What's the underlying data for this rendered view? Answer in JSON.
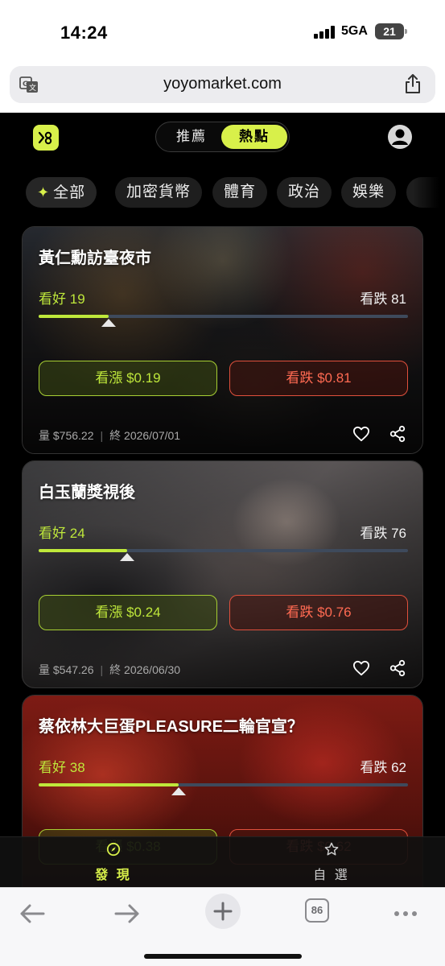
{
  "status": {
    "time": "14:24",
    "network": "5GA",
    "battery": "21"
  },
  "browser": {
    "url": "yoyomarket.com",
    "tab_count": "86"
  },
  "topnav": {
    "tabs": [
      {
        "label": "推薦",
        "active": false
      },
      {
        "label": "熱點",
        "active": true
      }
    ]
  },
  "categories": [
    {
      "label": "全部",
      "active": true
    },
    {
      "label": "加密貨幣",
      "active": false
    },
    {
      "label": "體育",
      "active": false
    },
    {
      "label": "政治",
      "active": false
    },
    {
      "label": "娛樂",
      "active": false
    }
  ],
  "markets": [
    {
      "title": "黃仁勳訪臺夜市",
      "bull_label": "看好",
      "bull_pct": 19,
      "bear_label": "看跌",
      "bear_pct": 81,
      "buy_label": "看漲 $0.19",
      "sell_label": "看跌 $0.81",
      "volume": "量 $756.22",
      "end": "終 2026/07/01"
    },
    {
      "title": "白玉蘭獎視後",
      "bull_label": "看好",
      "bull_pct": 24,
      "bear_label": "看跌",
      "bear_pct": 76,
      "buy_label": "看漲 $0.24",
      "sell_label": "看跌 $0.76",
      "volume": "量 $547.26",
      "end": "終 2026/06/30"
    },
    {
      "title": "蔡依林大巨蛋PLEASURE二輪官宣？",
      "bull_label": "看好",
      "bull_pct": 38,
      "bear_label": "看跌",
      "bear_pct": 62,
      "buy_label": "看漲 $0.38",
      "sell_label": "看跌 $0.62",
      "volume": "",
      "end": ""
    }
  ],
  "bottomnav": {
    "discover": "發 現",
    "favorites": "自 選"
  },
  "colors": {
    "accent": "#d8f04a",
    "bull": "#bfe83b",
    "bear": "#ff6a52",
    "background": "#000000"
  },
  "icons": [
    "translate-icon",
    "share-icon",
    "logo-icon",
    "profile-icon",
    "sparkle-icon",
    "heart-icon",
    "share-nodes-icon",
    "compass-icon",
    "star-icon",
    "back-arrow-icon",
    "forward-arrow-icon",
    "plus-icon",
    "more-icon"
  ]
}
